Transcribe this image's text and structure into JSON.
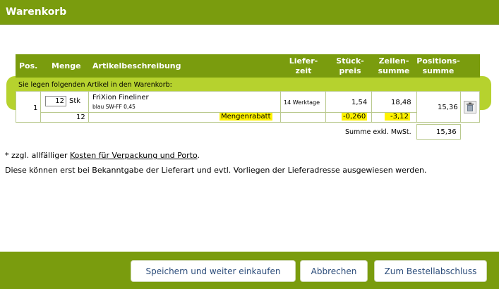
{
  "header": {
    "title": "Warenkorb"
  },
  "columns": {
    "pos": "Pos.",
    "menge": "Menge",
    "artikel": "Artikelbeschreibung",
    "liefer1": "Liefer-",
    "liefer2": "zeit",
    "stueck1": "Stück-",
    "stueck2": "preis",
    "zeilen1": "Zeilen-",
    "zeilen2": "summe",
    "positions1": "Positions-",
    "positions2": "summe"
  },
  "notice": "Sie legen folgenden Artikel in den Warenkorb:",
  "item": {
    "pos": "1",
    "qty_value": "12",
    "unit": "Stk",
    "name": "FriXion Fineliner",
    "variant": "blau SW-FF 0,45",
    "delivery": "14 Werktage",
    "unit_price": "1,54",
    "line_sum": "18,48",
    "position_sum": "15,36"
  },
  "discount": {
    "qty": "12",
    "label": "Mengenrabatt",
    "unit_price": "-0,260",
    "line_sum": "-3,12"
  },
  "summary": {
    "label": "Summe exkl. MwSt.",
    "value": "15,36"
  },
  "notes": {
    "prefix": "* zzgl. allfälliger ",
    "link": "Kosten für Verpackung und Porto",
    "suffix": ".",
    "line2": "Diese können erst bei Bekanntgabe der Lieferart und evtl. Vorliegen der Lieferadresse ausgewiesen werden."
  },
  "buttons": {
    "save": "Speichern und weiter einkaufen",
    "cancel": "Abbrechen",
    "checkout": "Zum Bestellabschluss"
  },
  "colors": {
    "brand_green": "#7a9c0e",
    "band_green": "#b6d22e",
    "highlight": "#fff200",
    "button_text": "#2b4c7a"
  },
  "icons": {
    "delete": "trash-icon"
  }
}
